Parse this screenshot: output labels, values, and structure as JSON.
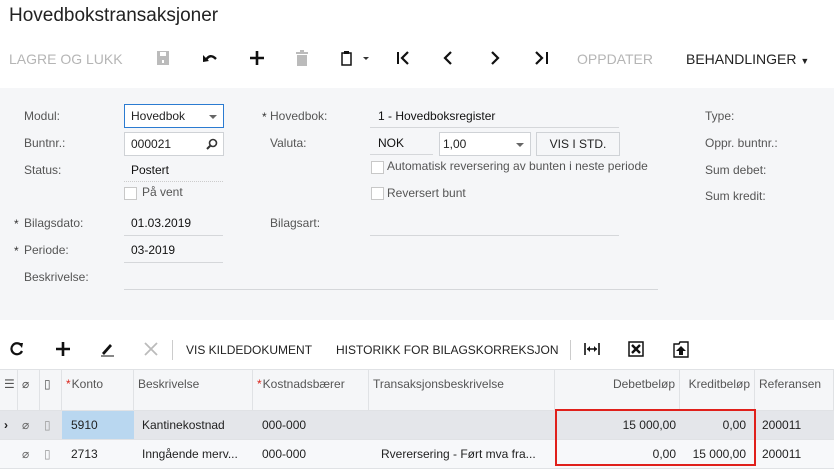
{
  "title": "Hovedbokstransaksjoner",
  "toolbar": {
    "save_close": "LAGRE OG LUKK",
    "refresh": "OPPDATER",
    "actions": "BEHANDLINGER"
  },
  "form": {
    "modul_label": "Modul:",
    "modul_value": "Hovedbok",
    "buntnr_label": "Buntnr.:",
    "buntnr_value": "000021",
    "status_label": "Status:",
    "status_value": "Postert",
    "pavent_label": "På vent",
    "bilagsdato_label": "Bilagsdato:",
    "bilagsdato_value": "01.03.2019",
    "periode_label": "Periode:",
    "periode_value": "03-2019",
    "beskrivelse_label": "Beskrivelse:",
    "hovedbok_label": "Hovedbok:",
    "hovedbok_value": "1 - Hovedboksregister",
    "valuta_label": "Valuta:",
    "valuta_value": "NOK",
    "rate_value": "1,00",
    "std_button": "VIS I STD.",
    "auto_rev_label": "Automatisk reversering av bunten i neste periode",
    "reversert_label": "Reversert bunt",
    "bilagsart_label": "Bilagsart:",
    "type_label": "Type:",
    "oppr_label": "Oppr. buntnr.:",
    "sum_debet_label": "Sum debet:",
    "sum_kredit_label": "Sum kredit:",
    "required_mark": "*"
  },
  "grid_toolbar": {
    "source_doc": "VIS KILDEDOKUMENT",
    "history": "HISTORIKK FOR BILAGSKORREKSJON"
  },
  "grid": {
    "columns": [
      "Konto",
      "Beskrivelse",
      "Kostnadsbærer",
      "Transaksjonsbeskrivelse",
      "Debetbeløp",
      "Kreditbeløp",
      "Referansen"
    ],
    "rows": [
      {
        "konto": "5910",
        "beskrivelse": "Kantinekostnad",
        "kostnad": "000-000",
        "trans": "",
        "debet": "15 000,00",
        "kredit": "0,00",
        "ref": "200011"
      },
      {
        "konto": "2713",
        "beskrivelse": "Inngående merv...",
        "kostnad": "000-000",
        "trans": "Rverersering - Ført mva fra...",
        "debet": "0,00",
        "kredit": "15 000,00",
        "ref": "200011"
      }
    ]
  },
  "colors": {
    "highlight_box": "#e0201b",
    "selected_cell": "#b9d7f0",
    "focus_border": "#2b7bd1"
  }
}
